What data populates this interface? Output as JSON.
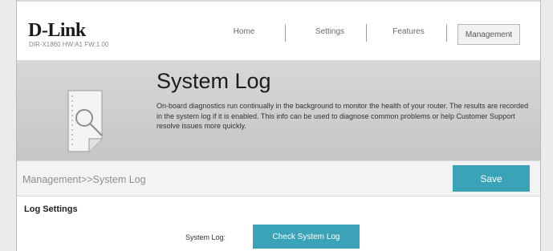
{
  "brand": {
    "logo_text": "D-Link",
    "model_info": "DIR-X1860 HW:A1 FW:1.00"
  },
  "nav": {
    "items": [
      {
        "label": "Home"
      },
      {
        "label": "Settings"
      },
      {
        "label": "Features"
      },
      {
        "label": "Management",
        "active": true
      }
    ]
  },
  "hero": {
    "title": "System Log",
    "description": "On-board diagnostics run continually in the background to monitor the health of your router. The results are recorded in the system log if it is enabled. This info can be used to diagnose common problems or help Customer Support resolve issues more quickly.",
    "icon": "log-search-icon"
  },
  "breadcrumb": {
    "text": "Management>>System Log"
  },
  "toolbar": {
    "save_label": "Save"
  },
  "log_settings": {
    "section_title": "Log Settings",
    "system_log_label": "System Log:",
    "check_button_label": "Check System Log"
  },
  "colors": {
    "accent": "#3aa3b7",
    "hero_bg": "#cfcfcf",
    "page_bg": "#ebebeb"
  }
}
